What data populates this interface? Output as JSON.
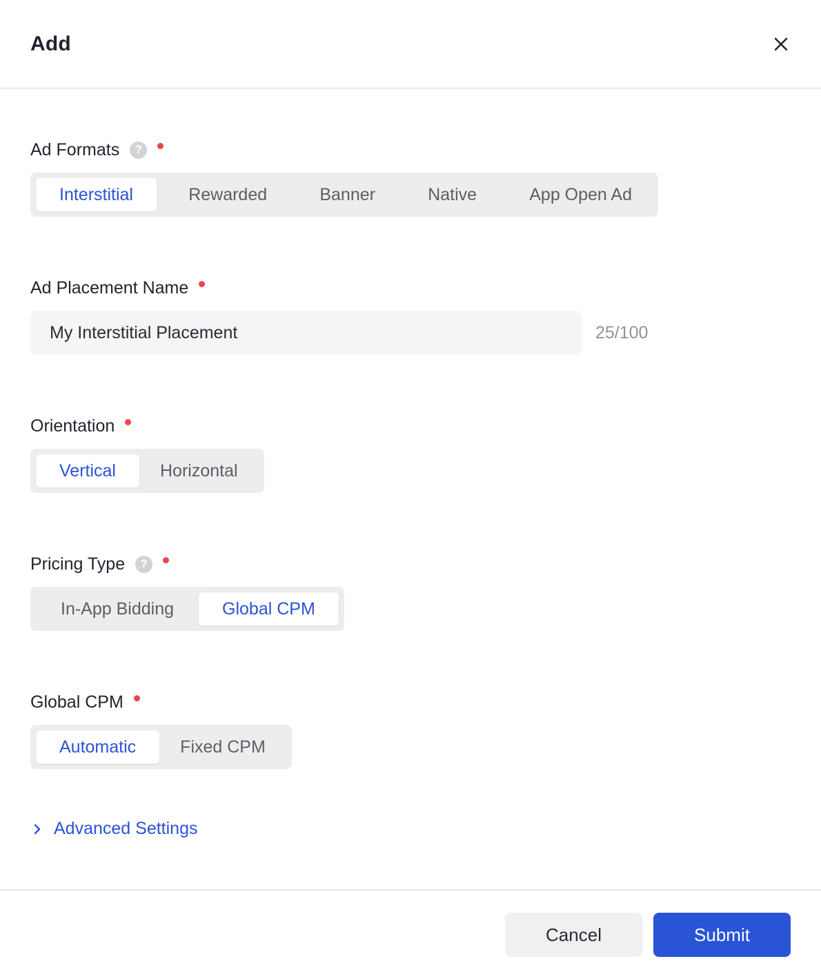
{
  "modal": {
    "title": "Add"
  },
  "sections": {
    "ad_formats": {
      "label": "Ad Formats",
      "options": [
        "Interstitial",
        "Rewarded",
        "Banner",
        "Native",
        "App Open Ad"
      ],
      "selected": "Interstitial"
    },
    "ad_placement_name": {
      "label": "Ad Placement Name",
      "value": "My Interstitial Placement",
      "counter": "25/100"
    },
    "orientation": {
      "label": "Orientation",
      "options": [
        "Vertical",
        "Horizontal"
      ],
      "selected": "Vertical"
    },
    "pricing_type": {
      "label": "Pricing Type",
      "options": [
        "In-App Bidding",
        "Global CPM"
      ],
      "selected": "Global CPM"
    },
    "global_cpm": {
      "label": "Global CPM",
      "options": [
        "Automatic",
        "Fixed CPM"
      ],
      "selected": "Automatic"
    }
  },
  "advanced_settings": {
    "label": "Advanced Settings"
  },
  "footer": {
    "cancel_label": "Cancel",
    "submit_label": "Submit"
  },
  "icons": {
    "help": "?",
    "close": "close-x",
    "chevron": "chevron-right"
  },
  "colors": {
    "accent": "#2a54d6",
    "required_dot": "#e5484d",
    "segmented_bg": "#ededee",
    "input_bg": "#f5f5f6",
    "cancel_bg": "#f0f0f1",
    "text_dark": "#20252e",
    "text_gray": "#5b5f66",
    "counter_gray": "#8e939c"
  }
}
